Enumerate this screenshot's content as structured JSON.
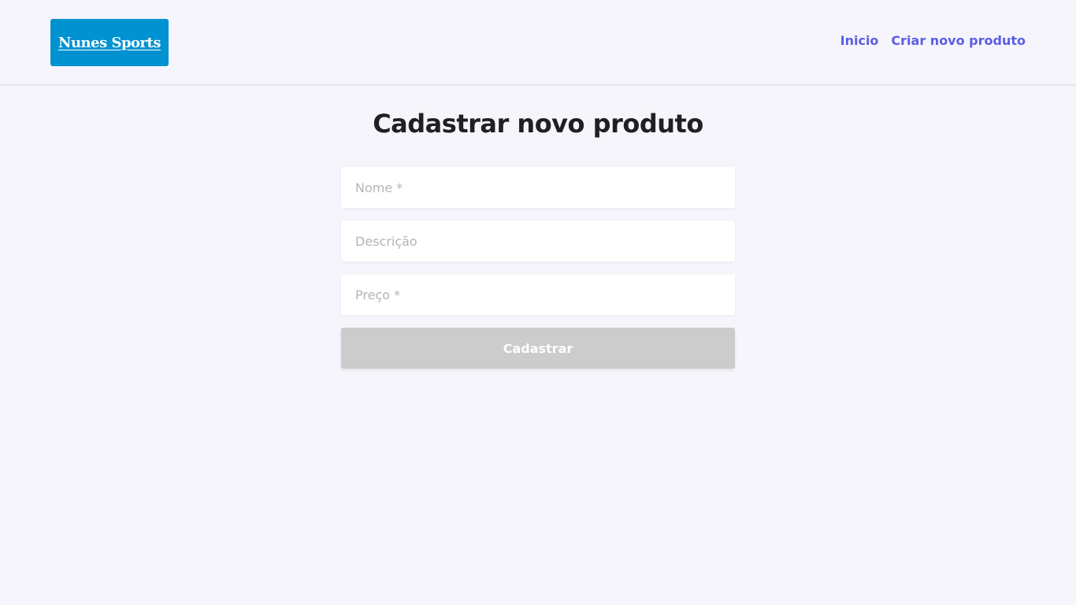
{
  "header": {
    "logo_text": "Nunes Sports",
    "nav": {
      "home_label": "Inicio",
      "create_label": "Criar novo produto"
    }
  },
  "main": {
    "title": "Cadastrar novo produto",
    "form": {
      "name_placeholder": "Nome *",
      "description_placeholder": "Descrição",
      "price_placeholder": "Preço *",
      "submit_label": "Cadastrar"
    }
  },
  "colors": {
    "background": "#f5f5fb",
    "logo_bg": "#0192d2",
    "nav_link": "#5b5ee6",
    "title": "#1f1f24",
    "button_disabled": "#cccccc"
  }
}
